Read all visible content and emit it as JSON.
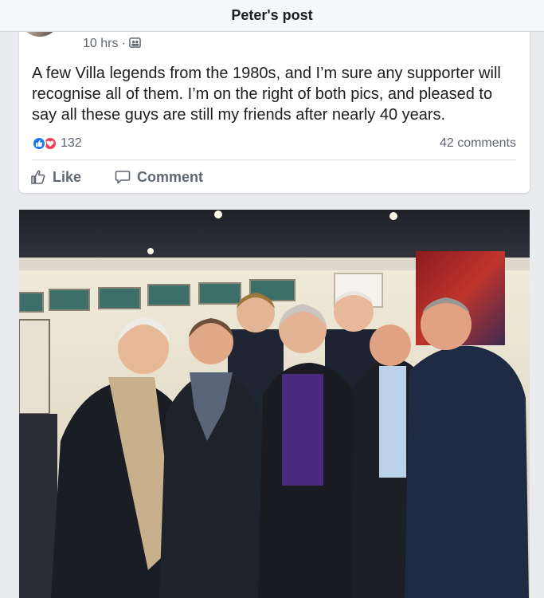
{
  "header": {
    "title": "Peter's post"
  },
  "post": {
    "time": "10 hrs",
    "separator": "·",
    "privacy_icon": "audience-icon",
    "text": "A few Villa legends from the 1980s, and I’m sure any supporter will recognise all of them. I’m on the right of both pics, and pleased to say all these guys are still my friends after nearly 40 years.",
    "reaction_count": "132",
    "comments": "42 comments",
    "like_label": "Like",
    "comment_label": "Comment"
  },
  "colors": {
    "like_blue": "#1877f2",
    "love_red": "#f33e58",
    "meta_gray": "#606770"
  }
}
